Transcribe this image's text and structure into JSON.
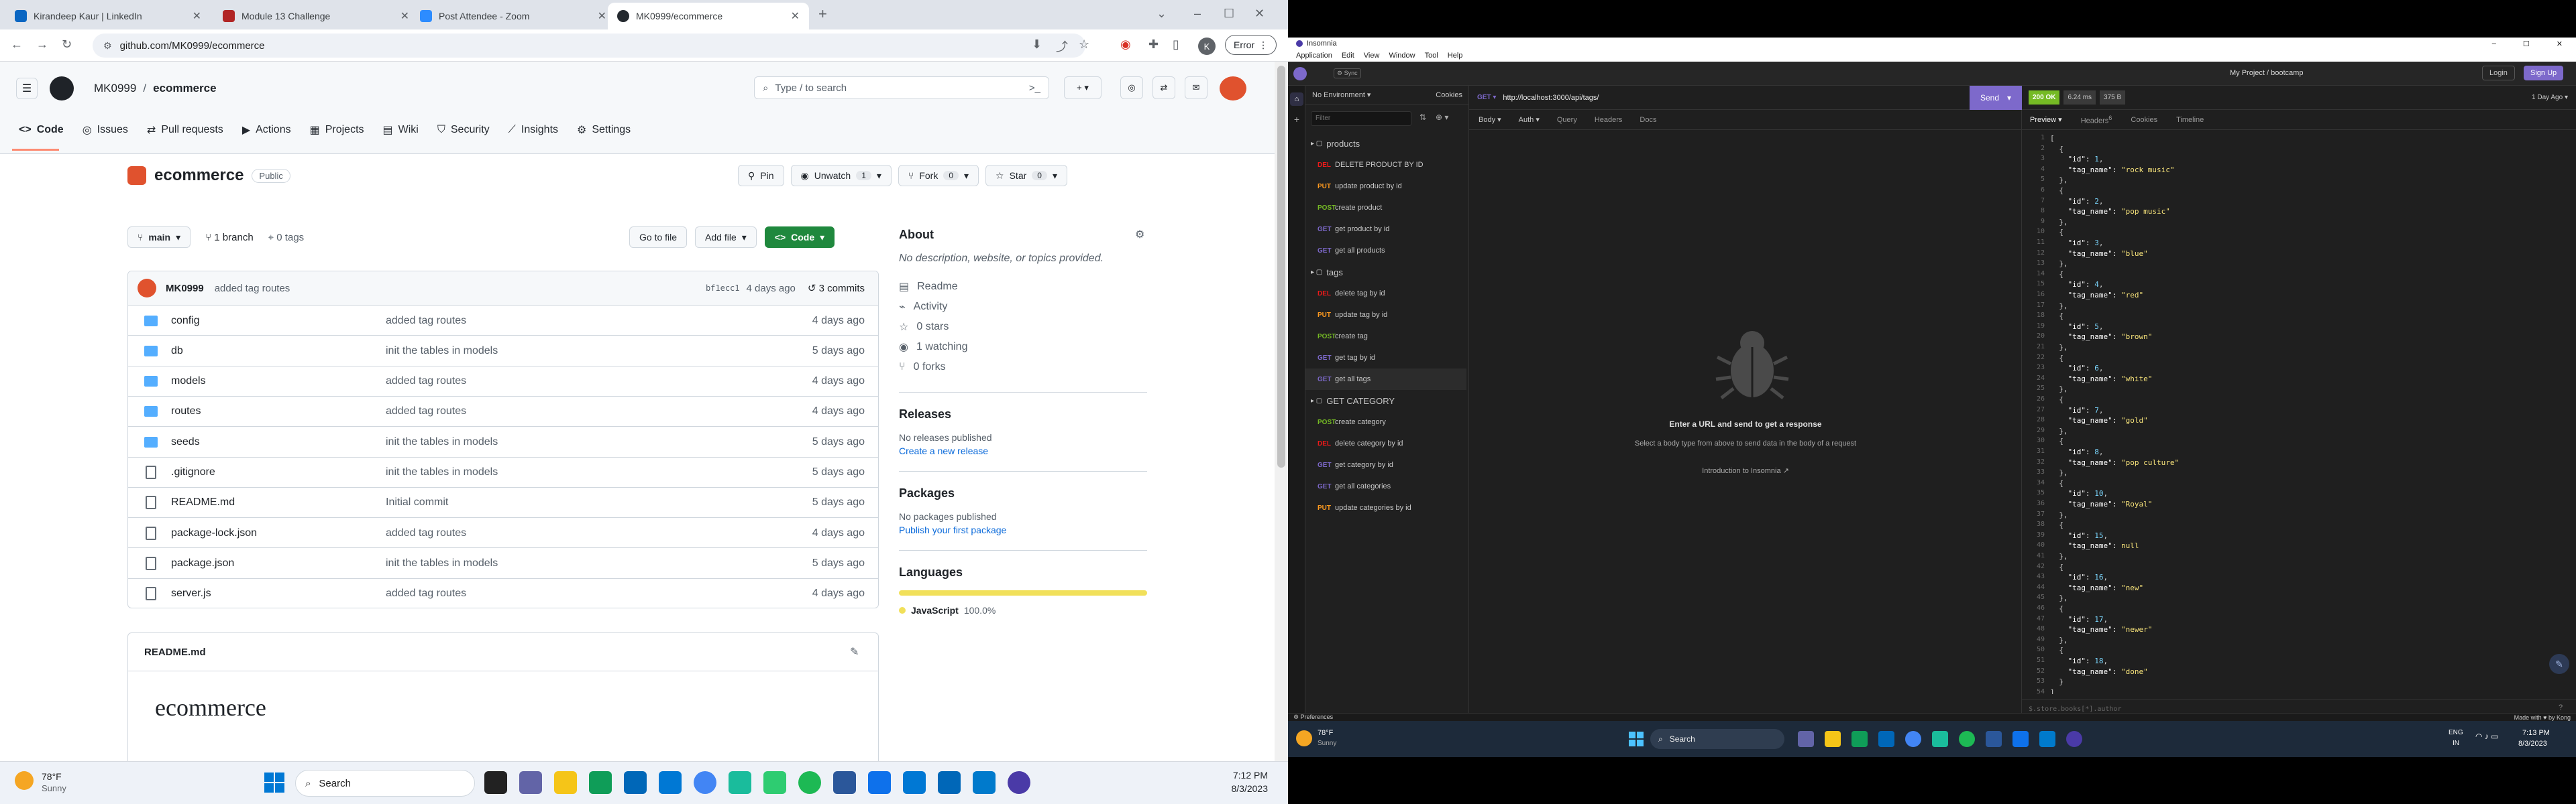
{
  "chrome": {
    "tabs": [
      {
        "label": "Kirandeep Kaur | LinkedIn",
        "color": "#0a66c2"
      },
      {
        "label": "Module 13 Challenge",
        "color": "#b12525"
      },
      {
        "label": "Post Attendee - Zoom",
        "color": "#2d8cff"
      },
      {
        "label": "MK0999/ecommerce",
        "color": "#24292f"
      }
    ],
    "new_tab": "+",
    "url": "github.com/MK0999/ecommerce",
    "profile": "K",
    "error_label": "Error"
  },
  "github": {
    "owner": "MK0999",
    "slash": "/",
    "repo": "ecommerce",
    "search_placeholder": "Type / to search",
    "nav": [
      {
        "label": "Code",
        "icon": "code-icon"
      },
      {
        "label": "Issues",
        "icon": "issue-icon"
      },
      {
        "label": "Pull requests",
        "icon": "pr-icon"
      },
      {
        "label": "Actions",
        "icon": "actions-icon"
      },
      {
        "label": "Projects",
        "icon": "projects-icon"
      },
      {
        "label": "Wiki",
        "icon": "wiki-icon"
      },
      {
        "label": "Security",
        "icon": "shield-icon"
      },
      {
        "label": "Insights",
        "icon": "graph-icon"
      },
      {
        "label": "Settings",
        "icon": "gear-icon"
      }
    ],
    "repo_title": "ecommerce",
    "visibility": "Public",
    "pin": "Pin",
    "unwatch": "Unwatch",
    "unwatch_count": "1",
    "fork": "Fork",
    "fork_count": "0",
    "star": "Star",
    "star_count": "0",
    "branch": "main",
    "branches": "1 branch",
    "tags": "0 tags",
    "goto_file": "Go to file",
    "add_file": "Add file",
    "code_button": "Code",
    "commit": {
      "author": "MK0999",
      "message": "added tag routes",
      "sha": "bf1ecc1",
      "time": "4 days ago",
      "commits": "3 commits"
    },
    "files": [
      {
        "name": "config",
        "type": "dir",
        "msg": "added tag routes",
        "time": "4 days ago"
      },
      {
        "name": "db",
        "type": "dir",
        "msg": "init the tables in models",
        "time": "5 days ago"
      },
      {
        "name": "models",
        "type": "dir",
        "msg": "added tag routes",
        "time": "4 days ago"
      },
      {
        "name": "routes",
        "type": "dir",
        "msg": "added tag routes",
        "time": "4 days ago"
      },
      {
        "name": "seeds",
        "type": "dir",
        "msg": "init the tables in models",
        "time": "5 days ago"
      },
      {
        "name": ".gitignore",
        "type": "file",
        "msg": "init the tables in models",
        "time": "5 days ago"
      },
      {
        "name": "README.md",
        "type": "file",
        "msg": "Initial commit",
        "time": "5 days ago"
      },
      {
        "name": "package-lock.json",
        "type": "file",
        "msg": "added tag routes",
        "time": "4 days ago"
      },
      {
        "name": "package.json",
        "type": "file",
        "msg": "init the tables in models",
        "time": "5 days ago"
      },
      {
        "name": "server.js",
        "type": "file",
        "msg": "added tag routes",
        "time": "4 days ago"
      }
    ],
    "readme_file": "README.md",
    "readme_title": "ecommerce",
    "about": {
      "title": "About",
      "desc": "No description, website, or topics provided.",
      "readme": "Readme",
      "activity": "Activity",
      "stars": "0 stars",
      "watching": "1 watching",
      "forks": "0 forks"
    },
    "releases": {
      "title": "Releases",
      "none": "No releases published",
      "link": "Create a new release"
    },
    "packages": {
      "title": "Packages",
      "none": "No packages published",
      "link": "Publish your first package"
    },
    "languages": {
      "title": "Languages",
      "name": "JavaScript",
      "pct": "100.0%",
      "color": "#f1e05a"
    }
  },
  "taskbar_left": {
    "temp": "78°F",
    "cond": "Sunny",
    "search": "Search",
    "time": "7:12 PM",
    "date": "8/3/2023"
  },
  "insomnia": {
    "title": "Insomnia",
    "menu": [
      "Application",
      "Edit",
      "View",
      "Window",
      "Tool",
      "Help"
    ],
    "project": "My Project / bootcamp",
    "login": "Login",
    "signup": "Sign Up",
    "env": "No Environment",
    "cookies": "Cookies",
    "filter_placeholder": "Filter",
    "method": "GET",
    "url": "http://localhost:3000/api/tags/",
    "send": "Send",
    "body": "Body",
    "auth": "Auth",
    "query": "Query",
    "headers": "Headers",
    "docs": "Docs",
    "status": "200 OK",
    "duration": "6.24 ms",
    "size": "375 B",
    "age": "1 Day Ago",
    "resp_tabs": [
      "Preview",
      "Headers",
      "Cookies",
      "Timeline"
    ],
    "headers_count": "6",
    "empty_title": "Enter a URL and send to get a response",
    "empty_sub": "Select a body type from above to send data in the body of a request",
    "intro": "Introduction to Insomnia",
    "folders": [
      {
        "name": "products",
        "items": [
          {
            "m": "DEL",
            "n": "DELETE PRODUCT BY ID"
          },
          {
            "m": "PUT",
            "n": "update product by id"
          },
          {
            "m": "POST",
            "n": "create product"
          },
          {
            "m": "GET",
            "n": "get product by id"
          },
          {
            "m": "GET",
            "n": "get all products"
          }
        ]
      },
      {
        "name": "tags",
        "items": [
          {
            "m": "DEL",
            "n": "delete tag by id"
          },
          {
            "m": "PUT",
            "n": "update tag by id"
          },
          {
            "m": "POST",
            "n": "create tag"
          },
          {
            "m": "GET",
            "n": "get tag by id"
          },
          {
            "m": "GET",
            "n": "get all tags"
          }
        ]
      },
      {
        "name": "GET CATEGORY",
        "items": [
          {
            "m": "POST",
            "n": "create category"
          },
          {
            "m": "DEL",
            "n": "delete category by id"
          },
          {
            "m": "GET",
            "n": "get category by id"
          },
          {
            "m": "GET",
            "n": "get all categories"
          },
          {
            "m": "PUT",
            "n": "update categories by id"
          }
        ]
      }
    ],
    "tags_json": [
      {
        "id": 1,
        "tag_name": "rock music"
      },
      {
        "id": 2,
        "tag_name": "pop music"
      },
      {
        "id": 3,
        "tag_name": "blue"
      },
      {
        "id": 4,
        "tag_name": "red"
      },
      {
        "id": 5,
        "tag_name": "brown"
      },
      {
        "id": 6,
        "tag_name": "white"
      },
      {
        "id": 7,
        "tag_name": "gold"
      },
      {
        "id": 8,
        "tag_name": "pop culture"
      },
      {
        "id": 10,
        "tag_name": "Royal"
      },
      {
        "id": 15,
        "tag_name": null
      },
      {
        "id": 16,
        "tag_name": "new"
      },
      {
        "id": 17,
        "tag_name": "newer"
      },
      {
        "id": 18,
        "tag_name": "done"
      }
    ],
    "filter_hint": "$.store.books[*].author",
    "preferences": "Preferences",
    "made_with": "Made with ♥ by Kong"
  },
  "taskbar_right": {
    "temp": "78°F",
    "cond": "Sunny",
    "search": "Search",
    "lang": "ENG",
    "region": "IN",
    "time": "7:13 PM",
    "date": "8/3/2023"
  },
  "colors": {
    "get": "#7d69cb",
    "post": "#75ba24",
    "put": "#ff9a1f",
    "del": "#ec1a1a",
    "accent": "#7d69cb",
    "ok": "#75ba24"
  }
}
